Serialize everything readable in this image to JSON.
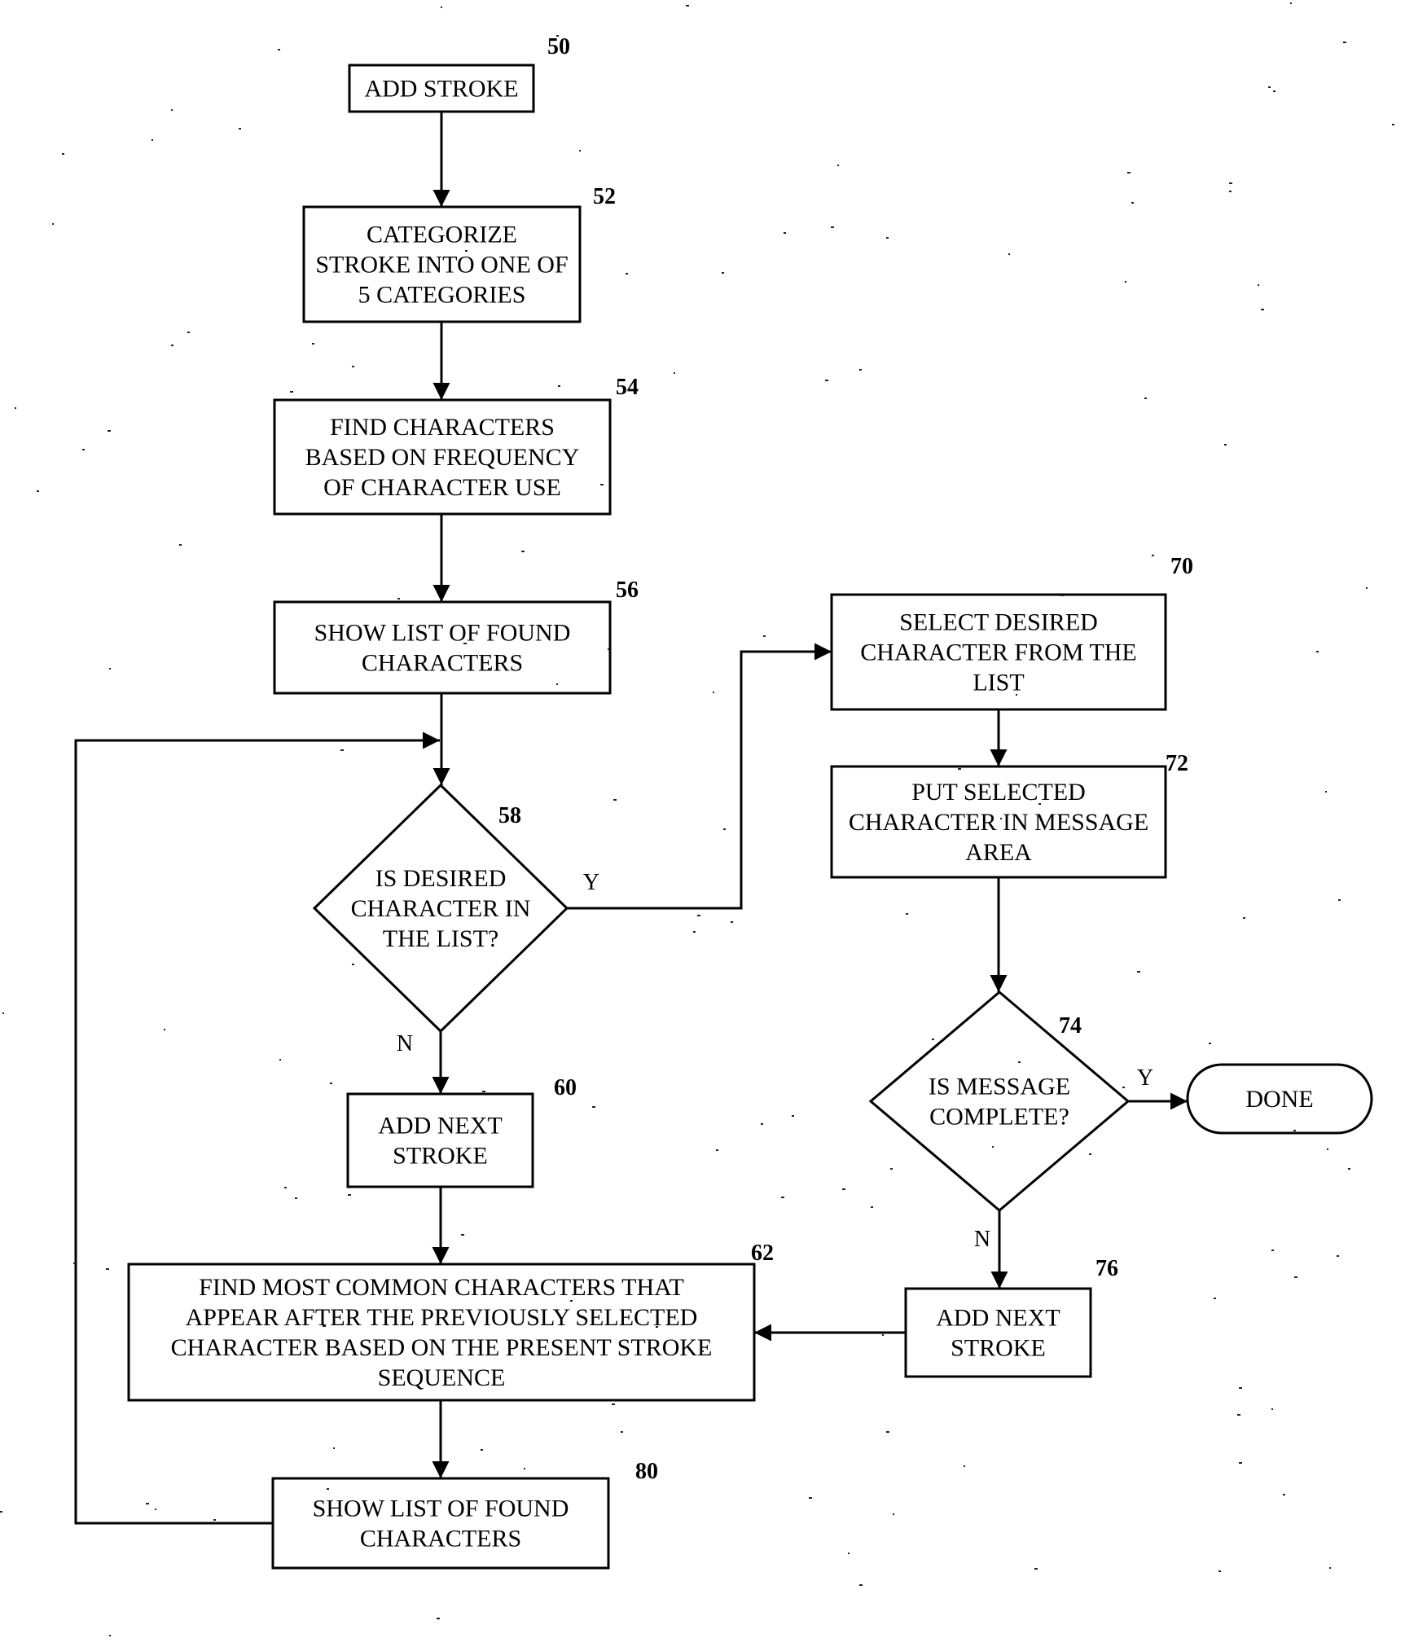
{
  "diagram": {
    "type": "flowchart",
    "nodes": [
      {
        "id": "50",
        "ref": "50",
        "shape": "rect",
        "lines": [
          "ADD STROKE"
        ]
      },
      {
        "id": "52",
        "ref": "52",
        "shape": "rect",
        "lines": [
          "CATEGORIZE",
          "STROKE INTO ONE OF",
          "5 CATEGORIES"
        ]
      },
      {
        "id": "54",
        "ref": "54",
        "shape": "rect",
        "lines": [
          "FIND CHARACTERS",
          "BASED ON FREQUENCY",
          "OF CHARACTER USE"
        ]
      },
      {
        "id": "56",
        "ref": "56",
        "shape": "rect",
        "lines": [
          "SHOW LIST OF FOUND",
          "CHARACTERS"
        ]
      },
      {
        "id": "58",
        "ref": "58",
        "shape": "diamond",
        "lines": [
          "IS DESIRED",
          "CHARACTER IN",
          "THE LIST?"
        ]
      },
      {
        "id": "60",
        "ref": "60",
        "shape": "rect",
        "lines": [
          "ADD NEXT",
          "STROKE"
        ]
      },
      {
        "id": "62",
        "ref": "62",
        "shape": "rect",
        "lines": [
          "FIND MOST COMMON CHARACTERS THAT",
          "APPEAR AFTER THE PREVIOUSLY SELECTED",
          "CHARACTER BASED ON THE PRESENT STROKE",
          "SEQUENCE"
        ]
      },
      {
        "id": "80",
        "ref": "80",
        "shape": "rect",
        "lines": [
          "SHOW LIST OF FOUND",
          "CHARACTERS"
        ]
      },
      {
        "id": "70",
        "ref": "70",
        "shape": "rect",
        "lines": [
          "SELECT DESIRED",
          "CHARACTER FROM THE",
          "LIST"
        ]
      },
      {
        "id": "72",
        "ref": "72",
        "shape": "rect",
        "lines": [
          "PUT SELECTED",
          "CHARACTER IN MESSAGE",
          "AREA"
        ]
      },
      {
        "id": "74",
        "ref": "74",
        "shape": "diamond",
        "lines": [
          "IS MESSAGE",
          "COMPLETE?"
        ]
      },
      {
        "id": "done",
        "ref": "",
        "shape": "terminator",
        "lines": [
          "DONE"
        ]
      },
      {
        "id": "76",
        "ref": "76",
        "shape": "rect",
        "lines": [
          "ADD NEXT",
          "STROKE"
        ]
      }
    ],
    "edges": [
      {
        "from": "50",
        "to": "52",
        "label": ""
      },
      {
        "from": "52",
        "to": "54",
        "label": ""
      },
      {
        "from": "54",
        "to": "56",
        "label": ""
      },
      {
        "from": "56",
        "to": "58",
        "label": ""
      },
      {
        "from": "58",
        "to": "70",
        "label": "Y"
      },
      {
        "from": "58",
        "to": "60",
        "label": "N"
      },
      {
        "from": "60",
        "to": "62",
        "label": ""
      },
      {
        "from": "62",
        "to": "80",
        "label": ""
      },
      {
        "from": "80",
        "to": "58",
        "label": ""
      },
      {
        "from": "70",
        "to": "72",
        "label": ""
      },
      {
        "from": "72",
        "to": "74",
        "label": ""
      },
      {
        "from": "74",
        "to": "done",
        "label": "Y"
      },
      {
        "from": "74",
        "to": "76",
        "label": "N"
      },
      {
        "from": "76",
        "to": "62",
        "label": ""
      }
    ]
  }
}
